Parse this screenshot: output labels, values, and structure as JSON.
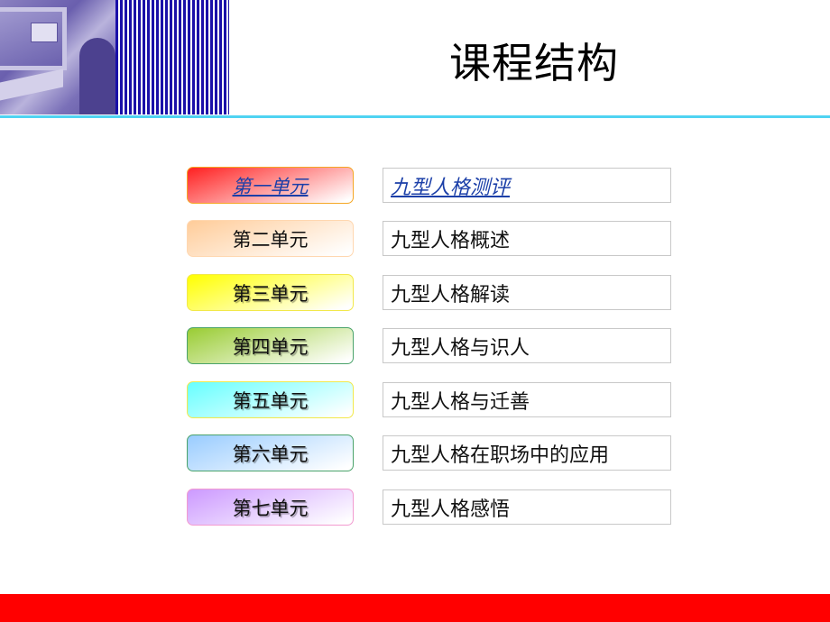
{
  "header": {
    "title": "课程结构",
    "rule_color": "#4fd3f2",
    "stripe_color": "#1a0fa8"
  },
  "units": [
    {
      "label": "第一单元",
      "topic": "九型人格测评",
      "style": "link",
      "gradient_from": "#ff2020",
      "border": "#f5a623"
    },
    {
      "label": "第二单元",
      "topic": "九型人格概述",
      "style": "plain",
      "gradient_from": "#ffcc99",
      "border": "#ffd7b0"
    },
    {
      "label": "第三单元",
      "topic": "九型人格解读",
      "style": "shadow",
      "gradient_from": "#ffff00",
      "border": "#f2e84a"
    },
    {
      "label": "第四单元",
      "topic": "九型人格与识人",
      "style": "shadow",
      "gradient_from": "#99cc33",
      "border": "#4aa36a"
    },
    {
      "label": "第五单元",
      "topic": "九型人格与迁善",
      "style": "shadow",
      "gradient_from": "#66ffff",
      "border": "#f2e84a"
    },
    {
      "label": "第六单元",
      "topic": "九型人格在职场中的应用",
      "style": "shadow",
      "gradient_from": "#99ccff",
      "border": "#4aa36a"
    },
    {
      "label": "第七单元",
      "topic": "九型人格感悟",
      "style": "shadow",
      "gradient_from": "#cc99ff",
      "border": "#f29ad0"
    }
  ],
  "footer": {
    "bar_color": "#ff0000"
  }
}
